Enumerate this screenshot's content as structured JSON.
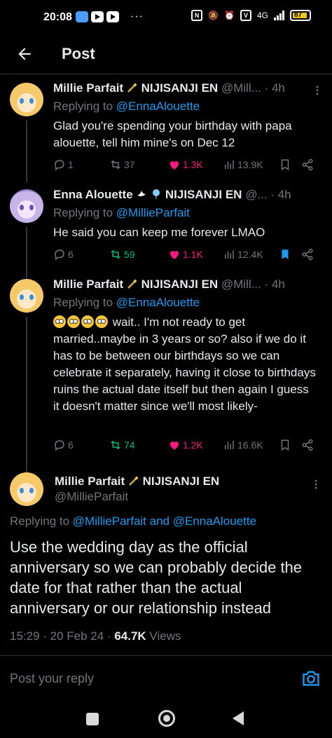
{
  "status_bar": {
    "time": "20:08",
    "dots": "···",
    "network": "4G",
    "battery": "87"
  },
  "header": {
    "title": "Post"
  },
  "replies": [
    {
      "name": "Millie Parfait",
      "org": "NIJISANJI EN",
      "handle": "@Mill...",
      "time": "· 4h",
      "replying_prefix": "Replying to ",
      "replying_to": "@EnnaAlouette",
      "text": "Glad you're spending your birthday with papa alouette, tell him mine's on Dec 12",
      "stats": {
        "replies": "1",
        "reposts": "37",
        "likes": "1.3K",
        "views": "13.9K"
      },
      "liked": true,
      "reposted": false,
      "bookmarked": false
    },
    {
      "name": "Enna Alouette",
      "org": "NIJISANJI EN",
      "handle": "@...",
      "time": "· 4h",
      "replying_prefix": "Replying to ",
      "replying_to": "@MillieParfait",
      "text": "He said you can keep me forever LMAO",
      "stats": {
        "replies": "6",
        "reposts": "59",
        "likes": "1.1K",
        "views": "12.4K"
      },
      "liked": true,
      "reposted": true,
      "bookmarked": true
    },
    {
      "name": "Millie Parfait",
      "org": "NIJISANJI EN",
      "handle": "@Mill...",
      "time": "· 4h",
      "replying_prefix": "Replying to ",
      "replying_to": "@EnnaAlouette",
      "text": " wait.. I'm not ready to get married..maybe in 3 years or so? also if we do it has to be between our birthdays so we can celebrate it separately, having it close to birthdays ruins the actual date itself but then again I guess it doesn't matter since we'll most likely-",
      "stats": {
        "replies": "6",
        "reposts": "74",
        "likes": "1.2K",
        "views": "16.6K"
      },
      "liked": true,
      "reposted": true,
      "bookmarked": false
    }
  ],
  "main_post": {
    "name": "Millie Parfait",
    "org": "NIJISANJI EN",
    "handle": "@MillieParfait",
    "replying_prefix": "Replying to ",
    "replying_to": "@MillieParfait and @EnnaAlouette",
    "text": "Use the wedding day as the official anniversary so we can probably decide the date for that rather than the actual anniversary or our relationship instead",
    "timestamp": "15:29 · 20 Feb 24 · ",
    "views_count": "64.7K",
    "views_label": " Views"
  },
  "reply_composer": {
    "placeholder": "Post your reply"
  },
  "colors": {
    "accent": "#1d9bf0",
    "like": "#f91880",
    "repost": "#00ba7c",
    "muted": "#71767b",
    "divider": "#2f3336"
  }
}
